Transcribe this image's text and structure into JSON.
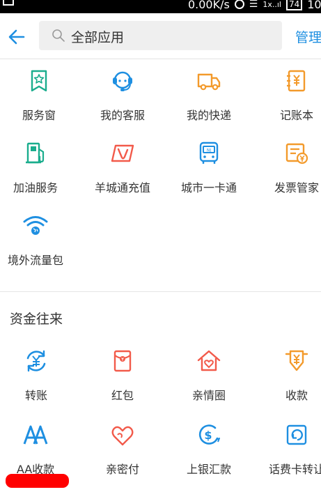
{
  "status_bar": {
    "speed": "0.00K/s",
    "signal": "1x..ıl",
    "battery": "74",
    "time": "10:"
  },
  "header": {
    "search_placeholder": "全部应用",
    "manage_label": "管理"
  },
  "apps": [
    {
      "label": "服务窗",
      "icon": "bookmark-star-icon",
      "color": "#1aad8d"
    },
    {
      "label": "我的客服",
      "icon": "headset-icon",
      "color": "#1e8fe1"
    },
    {
      "label": "我的快递",
      "icon": "truck-icon",
      "color": "#f39a2b"
    },
    {
      "label": "记账本",
      "icon": "ledger-icon",
      "color": "#f39a2b"
    },
    {
      "label": "加油服务",
      "icon": "gas-pump-icon",
      "color": "#1aad8d"
    },
    {
      "label": "羊城通充值",
      "icon": "ycard-icon",
      "color": "#f25a4a"
    },
    {
      "label": "城市一卡通",
      "icon": "bus-card-icon",
      "color": "#1e8fe1"
    },
    {
      "label": "发票管家",
      "icon": "invoice-icon",
      "color": "#f39a2b"
    },
    {
      "label": "境外流量包",
      "icon": "wifi-globe-icon",
      "color": "#1e8fe1"
    }
  ],
  "section": {
    "title": "资金往来"
  },
  "funds": [
    {
      "label": "转账",
      "icon": "transfer-icon",
      "color": "#1e8fe1"
    },
    {
      "label": "红包",
      "icon": "red-envelope-icon",
      "color": "#f25a4a"
    },
    {
      "label": "亲情圈",
      "icon": "family-house-icon",
      "color": "#f25a4a"
    },
    {
      "label": "收款",
      "icon": "receive-money-icon",
      "color": "#f39a2b"
    },
    {
      "label": "AA收款",
      "icon": "aa-icon",
      "color": "#1e8fe1"
    },
    {
      "label": "亲密付",
      "icon": "hearts-icon",
      "color": "#f25a4a"
    },
    {
      "label": "上银汇款",
      "icon": "dollar-remit-icon",
      "color": "#1e8fe1"
    },
    {
      "label": "话费卡转让",
      "icon": "phone-card-icon",
      "color": "#1e8fe1"
    }
  ]
}
